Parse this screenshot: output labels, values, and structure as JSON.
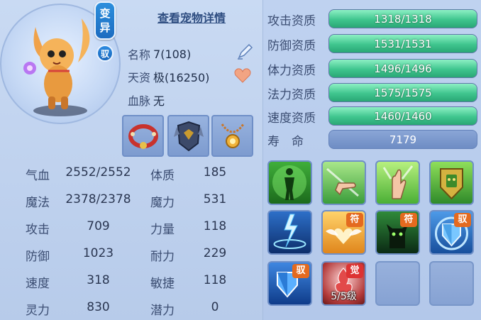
{
  "header": {
    "detail_link": "查看宠物详情"
  },
  "badges": {
    "variant_line1": "变",
    "variant_line2": "异",
    "tame": "驭"
  },
  "info": {
    "name_label": "名称",
    "name_value": "7(108)",
    "talent_label": "天资",
    "talent_value": "极(16250)",
    "bloodline_label": "血脉",
    "bloodline_value": "无"
  },
  "stats": [
    {
      "label": "气血",
      "value": "2552/2552"
    },
    {
      "label": "体质",
      "value": "185"
    },
    {
      "label": "魔法",
      "value": "2378/2378"
    },
    {
      "label": "魔力",
      "value": "531"
    },
    {
      "label": "攻击",
      "value": "709"
    },
    {
      "label": "力量",
      "value": "118"
    },
    {
      "label": "防御",
      "value": "1023"
    },
    {
      "label": "耐力",
      "value": "229"
    },
    {
      "label": "速度",
      "value": "318"
    },
    {
      "label": "敏捷",
      "value": "118"
    },
    {
      "label": "灵力",
      "value": "830"
    },
    {
      "label": "潜力",
      "value": "0"
    }
  ],
  "aptitudes": [
    {
      "label": "攻击资质",
      "value": "1318/1318",
      "fill": 1.0
    },
    {
      "label": "防御资质",
      "value": "1531/1531",
      "fill": 1.0
    },
    {
      "label": "体力资质",
      "value": "1496/1496",
      "fill": 1.0
    },
    {
      "label": "法力资质",
      "value": "1575/1575",
      "fill": 1.0
    },
    {
      "label": "速度资质",
      "value": "1460/1460",
      "fill": 1.0
    }
  ],
  "life": {
    "label": "寿　命",
    "value": "7179"
  },
  "skills": {
    "tag_fu": "符",
    "tag_yu": "驭",
    "tag_jue": "觉",
    "level_text": "5/5级"
  },
  "colors": {
    "aptitude_fill": "#3fc58e",
    "panel_bg": "#bcd0ee"
  }
}
